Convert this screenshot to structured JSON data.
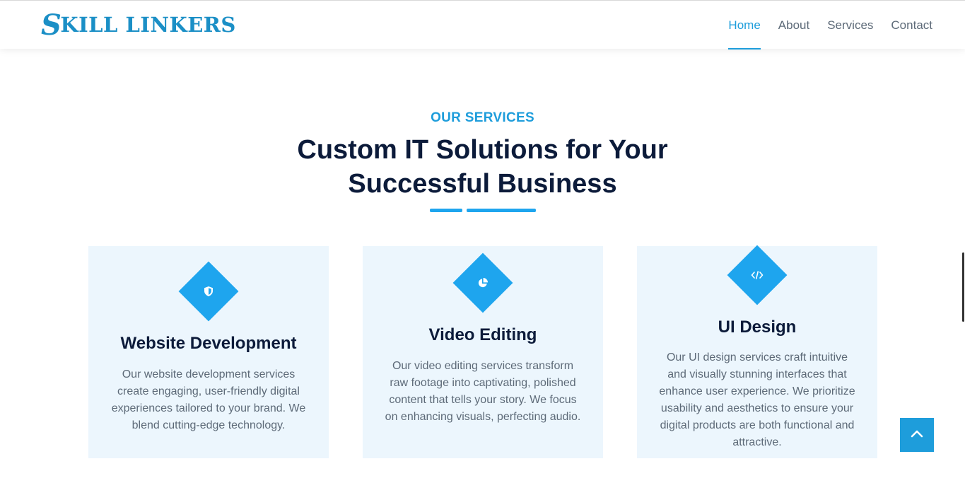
{
  "header": {
    "logo_initial": "S",
    "logo_rest": "KILL LINKERS",
    "nav": [
      {
        "label": "Home",
        "active": true
      },
      {
        "label": "About",
        "active": false
      },
      {
        "label": "Services",
        "active": false
      },
      {
        "label": "Contact",
        "active": false
      }
    ]
  },
  "section": {
    "eyebrow": "OUR SERVICES",
    "heading_line1": "Custom IT Solutions for Your",
    "heading_line2": "Successful Business"
  },
  "cards": [
    {
      "icon": "shield-icon",
      "title": "Website Development",
      "text": "Our website development services create engaging, user-friendly digital experiences tailored to your brand. We blend cutting-edge technology."
    },
    {
      "icon": "pie-chart-icon",
      "title": "Video Editing",
      "text": "Our video editing services transform raw footage into captivating, polished content that tells your story. We focus on enhancing visuals, perfecting audio."
    },
    {
      "icon": "code-icon",
      "title": "UI Design",
      "text": "Our UI design services craft intuitive and visually stunning interfaces that enhance user experience. We prioritize usability and aesthetics to ensure your digital products are both functional and attractive."
    }
  ],
  "back_to_top_icon": "chevron-up-icon",
  "colors": {
    "accent": "#1e9ddb",
    "heading": "#0c1b3a",
    "body_text": "#5d6a78",
    "card_bg": "#ecf6fd"
  }
}
